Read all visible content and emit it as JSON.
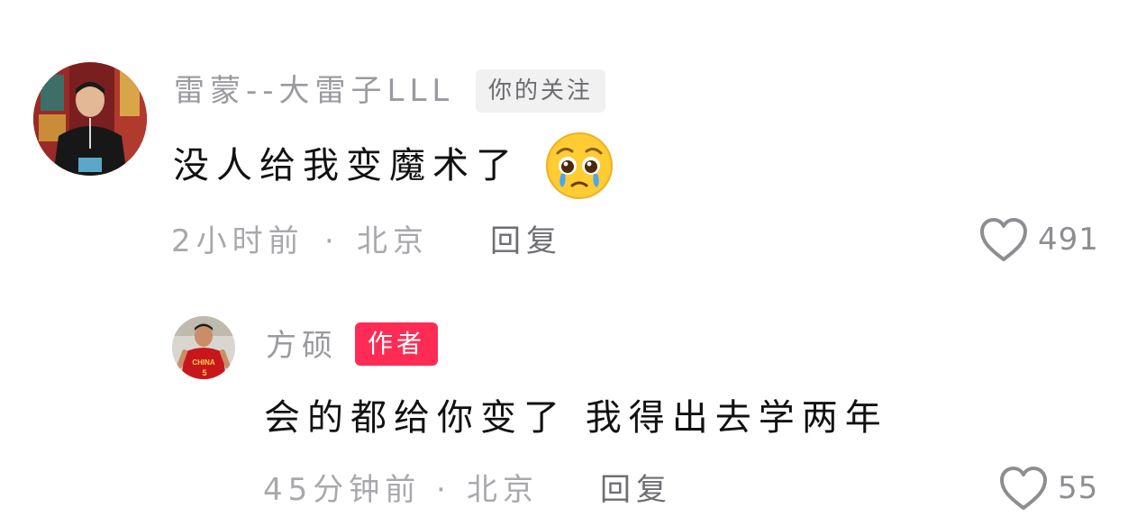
{
  "comments": [
    {
      "username": "雷蒙--大雷子LLL",
      "badge": "你的关注",
      "text": "没人给我变魔术了",
      "emoji": "pleading-face-crying",
      "time": "2小时前",
      "separator": "·",
      "location": "北京",
      "reply_label": "回复",
      "likes": "491"
    },
    {
      "username": "方硕",
      "badge": "作者",
      "text": "会的都给你变了 我得出去学两年",
      "time": "45分钟前",
      "separator": "·",
      "location": "北京",
      "reply_label": "回复",
      "likes": "55",
      "avatar_jersey_text": "CHINA"
    }
  ],
  "colors": {
    "author_badge": "#fe2c55",
    "follow_badge_bg": "#f1f1f2",
    "meta_text": "#a8a8ad"
  },
  "icons": {
    "like": "heart-outline-icon"
  }
}
